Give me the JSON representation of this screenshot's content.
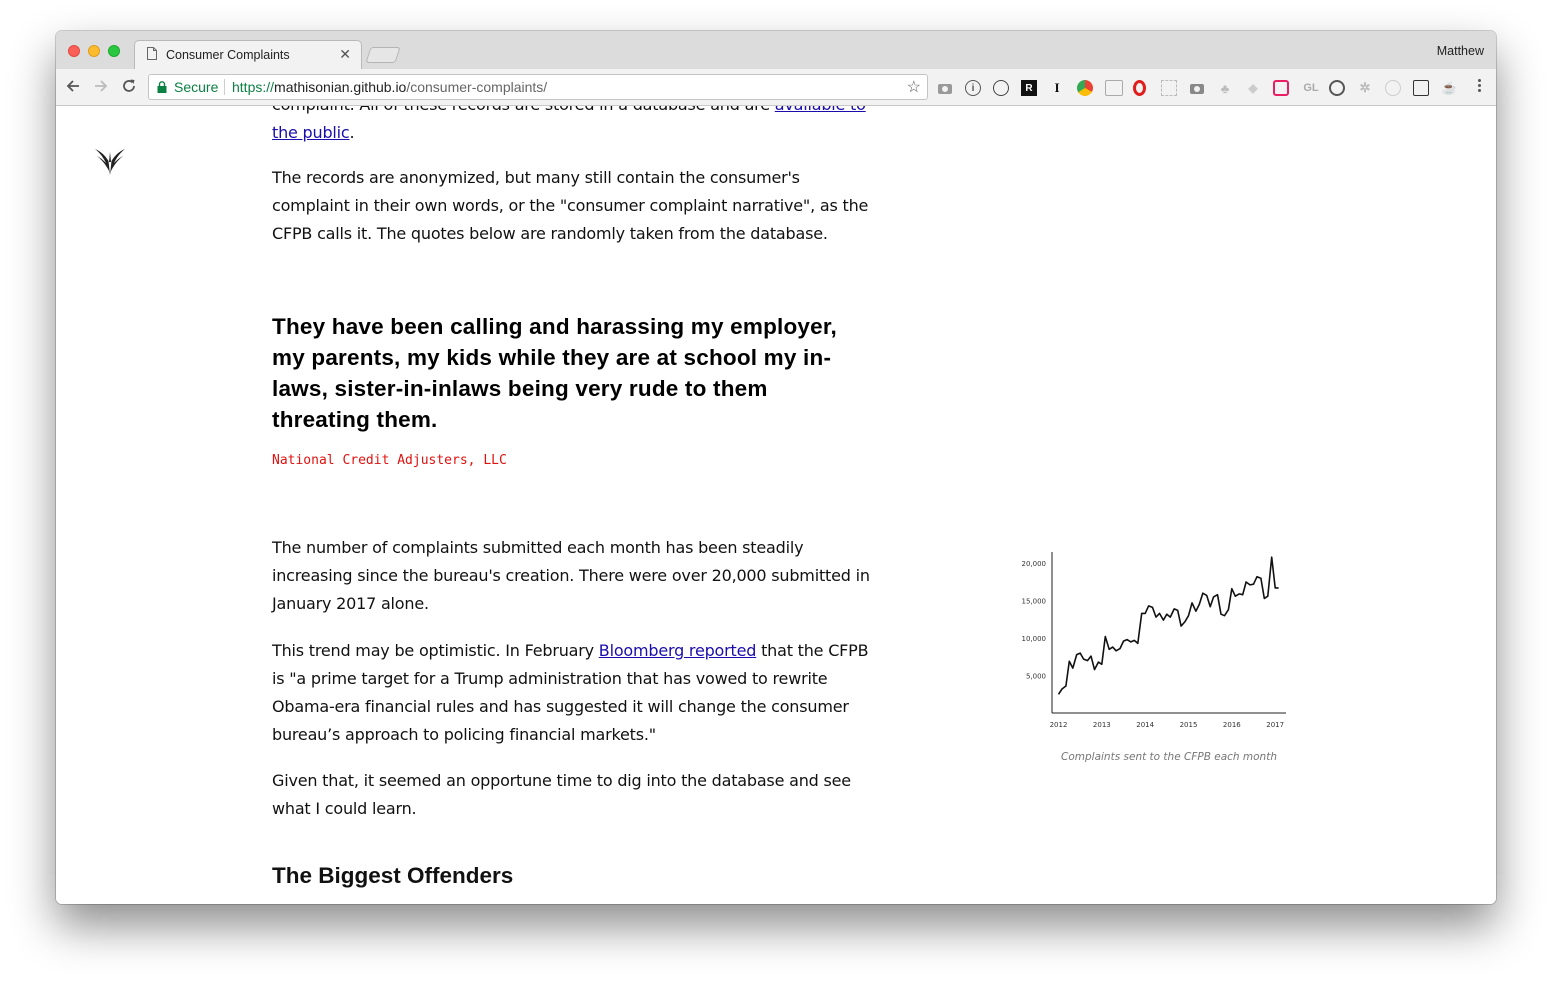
{
  "browser": {
    "tab_title": "Consumer Complaints",
    "profile_name": "Matthew",
    "security_label": "Secure",
    "url_scheme": "https://",
    "url_host": "mathisonian.github.io",
    "url_path": "/consumer-complaints/"
  },
  "article": {
    "p0_before": "complaint. All of these records are stored in a database and are ",
    "p0_link": "available to the public",
    "p0_after": ".",
    "p1": "The records are anonymized, but many still contain the consumer's complaint in their own words, or the \"consumer complaint narrative\", as the CFPB calls it. The quotes below are randomly taken from the database.",
    "quote": "They have been calling and harassing my employer, my parents, my kids while they are at school my in-laws, sister-in-inlaws being very rude to them threating them.",
    "quote_company": "National Credit Adjusters, LLC",
    "p2": "The number of complaints submitted each month has been steadily increasing since the bureau's creation. There were over 20,000 submitted in January 2017 alone.",
    "p3_before": "This trend may be optimistic. In February ",
    "p3_link": "Bloomberg reported",
    "p3_after": " that the CFPB is \"a prime target for a Trump administration that has vowed to rewrite Obama-era financial rules and has suggested it will change the consumer bureau’s approach to policing financial markets.\"",
    "p4": "Given that, it seemed an opportune time to dig into the database and see what I could learn.",
    "heading": "The Biggest Offenders"
  },
  "chart_data": {
    "type": "line",
    "caption": "Complaints sent to the CFPB each month",
    "x_ticks": [
      "2012",
      "2013",
      "2014",
      "2015",
      "2016",
      "2017"
    ],
    "y_ticks": [
      "5,000",
      "10,000",
      "15,000",
      "20,000"
    ],
    "ylim": [
      0,
      21500
    ],
    "xlim": [
      2011.85,
      2017.25
    ],
    "grid": false,
    "series": [
      {
        "color": "#111111",
        "x": [
          2012.0,
          2012.08,
          2012.17,
          2012.25,
          2012.33,
          2012.42,
          2012.5,
          2012.58,
          2012.67,
          2012.75,
          2012.83,
          2012.92,
          2013.0,
          2013.08,
          2013.17,
          2013.25,
          2013.33,
          2013.42,
          2013.5,
          2013.58,
          2013.67,
          2013.75,
          2013.83,
          2013.92,
          2014.0,
          2014.08,
          2014.17,
          2014.25,
          2014.33,
          2014.42,
          2014.5,
          2014.58,
          2014.67,
          2014.75,
          2014.83,
          2014.92,
          2015.0,
          2015.08,
          2015.17,
          2015.25,
          2015.33,
          2015.42,
          2015.5,
          2015.58,
          2015.67,
          2015.75,
          2015.83,
          2015.92,
          2016.0,
          2016.08,
          2016.17,
          2016.25,
          2016.33,
          2016.42,
          2016.5,
          2016.58,
          2016.67,
          2016.75,
          2016.83,
          2016.92,
          2017.0,
          2017.08
        ],
        "values": [
          2500,
          3200,
          3600,
          6900,
          6000,
          7800,
          8000,
          7200,
          7000,
          7600,
          5800,
          6800,
          6500,
          10200,
          8500,
          8800,
          8300,
          8600,
          9600,
          9800,
          9500,
          9700,
          9300,
          13300,
          13300,
          14300,
          14100,
          12800,
          13300,
          12400,
          13200,
          12800,
          13900,
          13700,
          11600,
          12200,
          13000,
          14700,
          13600,
          14500,
          16000,
          15700,
          14200,
          15500,
          15800,
          13200,
          13000,
          13800,
          16600,
          15600,
          15900,
          15800,
          17500,
          17100,
          17200,
          18200,
          18000,
          15300,
          15600,
          20800,
          16700,
          16700
        ]
      }
    ]
  }
}
